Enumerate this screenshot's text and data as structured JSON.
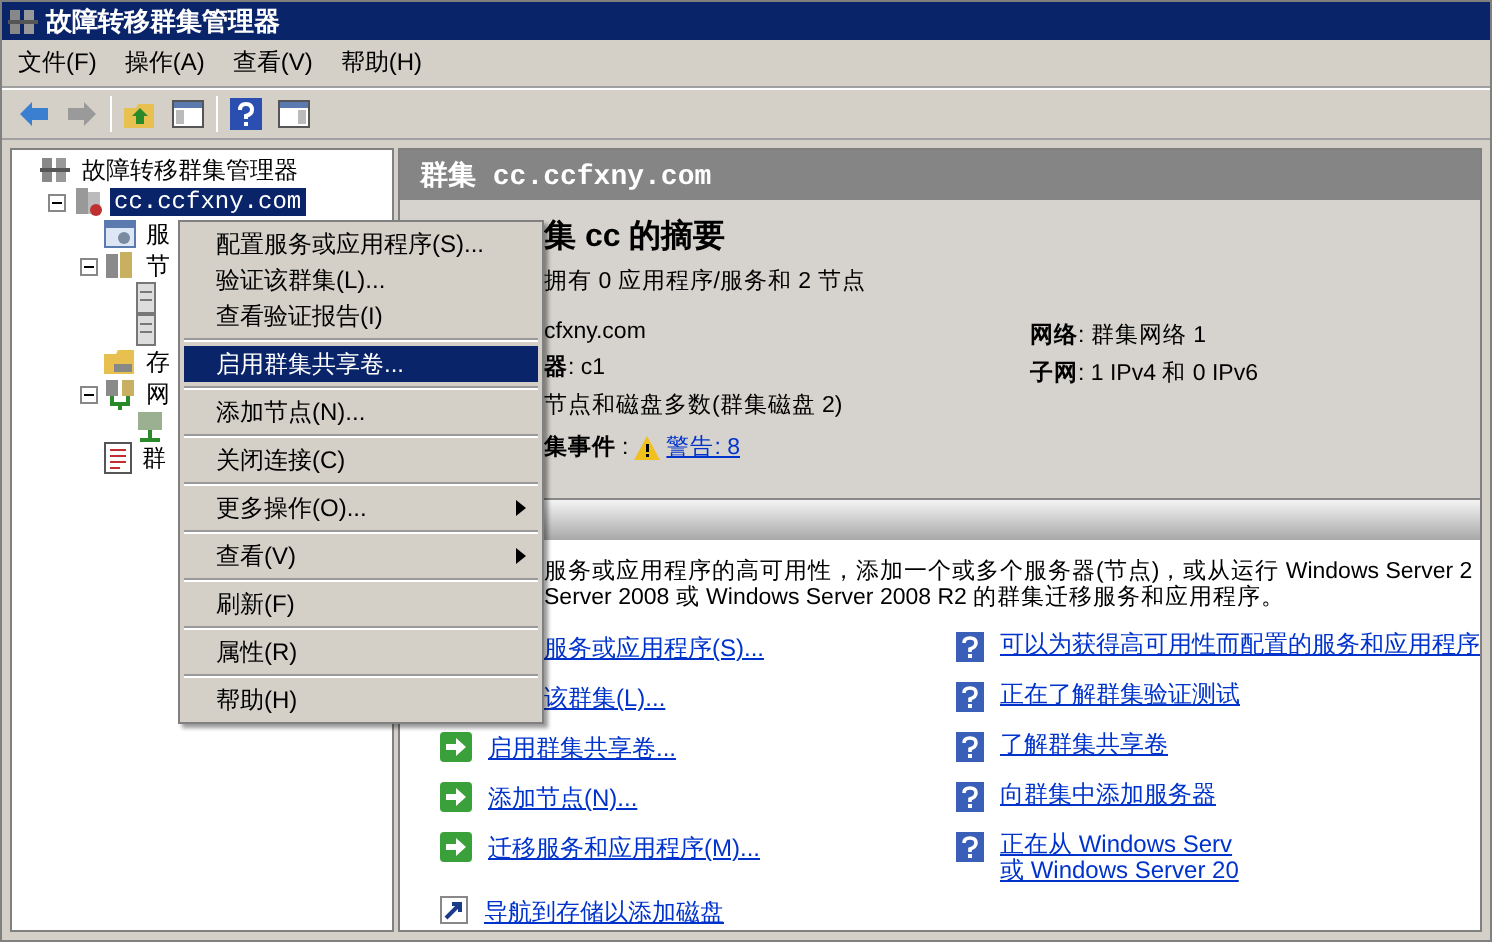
{
  "window": {
    "title": "故障转移群集管理器"
  },
  "menu_bar": [
    {
      "label": "文件(F)"
    },
    {
      "label": "操作(A)"
    },
    {
      "label": "查看(V)"
    },
    {
      "label": "帮助(H)"
    }
  ],
  "toolbar": [
    {
      "kind": "back"
    },
    {
      "kind": "forward"
    },
    {
      "kind": "separator"
    },
    {
      "kind": "up"
    },
    {
      "kind": "tree"
    },
    {
      "kind": "separator"
    },
    {
      "kind": "help"
    },
    {
      "kind": "pane"
    }
  ],
  "tree": [
    {
      "label": "故障转移群集管理器",
      "kind": "cluster",
      "selected": false,
      "children": [
        {
          "label": "cc.ccfxny.com",
          "kind": "clusternode",
          "selected": true,
          "expanded": true,
          "children": [
            {
              "label": "服",
              "kind": "service",
              "selected": false
            },
            {
              "label": "节",
              "kind": "nodes",
              "selected": false,
              "expanded": true,
              "children": [
                {
                  "kind": "server"
                },
                {
                  "kind": "server"
                }
              ]
            },
            {
              "label": "存",
              "kind": "storage",
              "selected": false
            },
            {
              "label": "网",
              "kind": "network",
              "selected": false,
              "expanded": true,
              "children": [
                {
                  "kind": "netitem"
                }
              ]
            },
            {
              "label": "群",
              "kind": "events",
              "selected": false
            }
          ]
        }
      ]
    }
  ],
  "panel": {
    "header": "群集 cc.ccfxny.com",
    "summary_title": "集 cc 的摘要",
    "summary_line": "拥有 0 应用程序/服务和 2 节点",
    "details_left": [
      {
        "value": "cfxny.com"
      },
      {
        "label": "器",
        "value": ": c1"
      },
      {
        "value": "节点和磁盘多数(群集磁盘 2)"
      }
    ],
    "details_right": [
      {
        "label": "网络",
        "value": ": 群集网络 1"
      },
      {
        "label": "子网",
        "value": ": 1 IPv4 和 0 IPv6"
      }
    ],
    "events": {
      "label": "集事件",
      "separator": ":",
      "link": "警告: 8"
    },
    "intro": [
      "服务或应用程序的高可用性，添加一个或多个服务器(节点)，或从运行 Windows Server 2",
      "Server 2008 或 Windows Server 2008 R2 的群集迁移服务和应用程序。"
    ],
    "actions": [
      {
        "label": "服务或应用程序(S)..."
      },
      {
        "label": "该群集(L)..."
      },
      {
        "label": "启用群集共享卷...",
        "kind": "arrow"
      },
      {
        "label": "添加节点(N)...",
        "kind": "arrow"
      },
      {
        "label": "迁移服务和应用程序(M)...",
        "kind": "arrow"
      }
    ],
    "storage_link": {
      "label": "导航到存储以添加磁盘"
    },
    "help_links": [
      {
        "lines": [
          "可以为获得高可用性而配置的服务和应用程序"
        ]
      },
      {
        "lines": [
          "正在了解群集验证测试"
        ]
      },
      {
        "lines": [
          "了解群集共享卷"
        ]
      },
      {
        "lines": [
          "向群集中添加服务器"
        ]
      },
      {
        "lines": [
          "正在从 Windows Serv",
          "或 Windows Server 20"
        ]
      }
    ]
  },
  "context_menu": [
    [
      {
        "label": "配置服务或应用程序(S)...",
        "selected": false,
        "submenu": false
      },
      {
        "label": "验证该群集(L)...",
        "selected": false,
        "submenu": false
      },
      {
        "label": "查看验证报告(I)",
        "selected": false,
        "submenu": false
      }
    ],
    [
      {
        "label": "启用群集共享卷...",
        "selected": true,
        "submenu": false
      }
    ],
    [
      {
        "label": "添加节点(N)...",
        "selected": false,
        "submenu": false
      }
    ],
    [
      {
        "label": "关闭连接(C)",
        "selected": false,
        "submenu": false
      }
    ],
    [
      {
        "label": "更多操作(O)...",
        "selected": false,
        "submenu": true
      }
    ],
    [
      {
        "label": "查看(V)",
        "selected": false,
        "submenu": true
      }
    ],
    [
      {
        "label": "刷新(F)",
        "selected": false,
        "submenu": false
      }
    ],
    [
      {
        "label": "属性(R)",
        "selected": false,
        "submenu": false
      }
    ],
    [
      {
        "label": "帮助(H)",
        "selected": false,
        "submenu": false
      }
    ]
  ]
}
